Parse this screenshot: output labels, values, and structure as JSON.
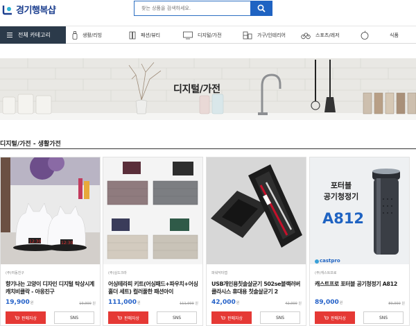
{
  "header": {
    "logo_text": "경기행복샵",
    "search_placeholder": "찾는 상품을 검색하세요."
  },
  "nav": {
    "all_categories": "전체 카테고리",
    "items": [
      {
        "label": "생활/리빙",
        "icon": "bottle-icon"
      },
      {
        "label": "패션/뷰티",
        "icon": "hanger-icon"
      },
      {
        "label": "디지털/가전",
        "icon": "monitor-icon"
      },
      {
        "label": "가구/인테리어",
        "icon": "furniture-icon"
      },
      {
        "label": "스포츠/레저",
        "icon": "bike-icon"
      },
      {
        "label": "식품",
        "icon": "apple-icon"
      }
    ]
  },
  "banner": {
    "title": "디지털/가전"
  },
  "section": {
    "title": "디지털/가전 - 생활가전"
  },
  "products": [
    {
      "seller": "(주)여동친구",
      "name": "향기나는 고양이 디자인 디지털 탁상시계 캐치비클락 - 아웅친구",
      "price": "19,900",
      "price_unit": "원",
      "orig_price": "19,900",
      "orig_unit": "원",
      "buy_label": "판매자상",
      "sns_label": "SNS"
    },
    {
      "seller": "(주)실드크라",
      "name": "어싱테라피 키트(어싱패드+파우치+어싱홀더 세트) 컬러풀한 패션아이",
      "price": "111,000",
      "price_unit": "원",
      "orig_price": "111,000",
      "orig_unit": "원",
      "buy_label": "판매자상",
      "sns_label": "SNS"
    },
    {
      "seller": "파워닥터랩",
      "name": "USB개인용칫솔살균기 502se블랙러버 클라시스 휴대용 칫솔살균기 2",
      "price": "42,000",
      "price_unit": "원",
      "orig_price": "42,000",
      "orig_unit": "원",
      "buy_label": "판매자상",
      "sns_label": "SNS"
    },
    {
      "seller": "(주)캐스트프로",
      "name": "캐스트프로 포터블 공기청정기 A812",
      "price": "89,000",
      "price_unit": "원",
      "orig_price": "89,000",
      "orig_unit": "원",
      "buy_label": "판매자상",
      "sns_label": "SNS",
      "image_text": [
        "포터블",
        "공기청정기",
        "A812"
      ],
      "brand": "castpro"
    }
  ],
  "colors": {
    "accent": "#1f63c2",
    "nav_dark": "#2b3a4a",
    "buy_red": "#e53935",
    "price_blue": "#2461c8"
  }
}
